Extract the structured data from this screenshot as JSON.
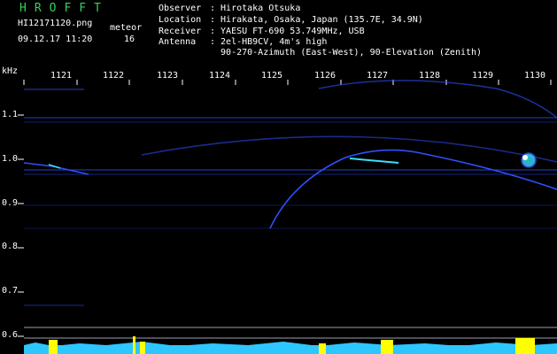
{
  "header": {
    "logo": "HROFFT",
    "filename": "HI12171120.png",
    "datetime": "09.12.17 11:20",
    "meteor_label": "meteor",
    "meteor_count": "16"
  },
  "info": [
    {
      "key": "Observer",
      "value": ": Hirotaka Otsuka"
    },
    {
      "key": "Location",
      "value": ": Hirakata, Osaka, Japan (135.7E, 34.9N)"
    },
    {
      "key": "Receiver",
      "value": ": YAESU FT-690 53.749MHz, USB"
    },
    {
      "key": "Antenna",
      "value": ": 2el-HB9CV, 4m's high"
    },
    {
      "key": "",
      "value": "  90-270-Azimuth (East-West), 90-Elevation (Zenith)"
    }
  ],
  "axis": {
    "unit": "kHz",
    "minutes": [
      "1121",
      "1122",
      "1123",
      "1124",
      "1125",
      "1126",
      "1127",
      "1128",
      "1129",
      "1130"
    ],
    "freq_labels": [
      "1.1",
      "1.0",
      "0.9",
      "0.8",
      "0.7",
      "0.6"
    ]
  },
  "colors": {
    "background": "#000000",
    "logo": "#34d15a",
    "text": "#ffffff",
    "trace": "#2f4fff",
    "trace_hot": "#37e0ff",
    "baseline": "#2ec6ff",
    "peak": "#ffff00"
  }
}
